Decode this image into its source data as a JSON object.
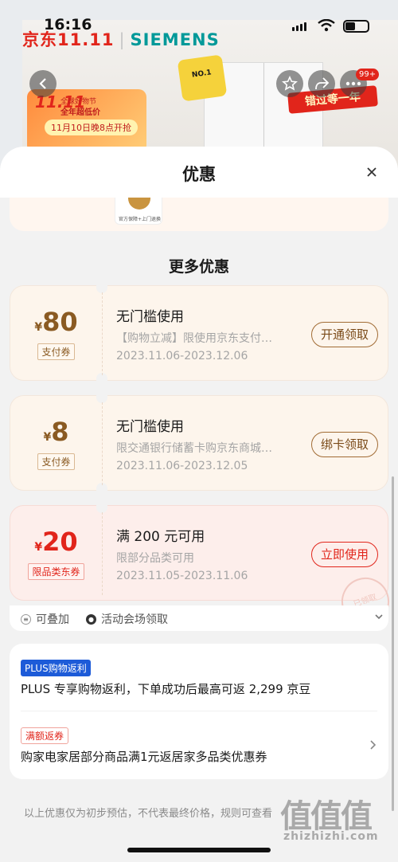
{
  "status_bar": {
    "time": "16:16"
  },
  "background": {
    "brand_jd": "京东11.11",
    "brand_siemens": "SIEMENS",
    "promo_logo": "11.11",
    "promo_line1": "全球好物节",
    "promo_line2": "全年超低价",
    "promo_pill": "11月10日晚8点开抢",
    "ribbon": "错过等一年",
    "badge_text": "NO.1",
    "cart_badge": "99+"
  },
  "sheet": {
    "title": "优惠",
    "prev_card_logo_text": "官方保障+上门退换",
    "section_title": "更多优惠",
    "coupons": [
      {
        "currency": "¥",
        "amount": "80",
        "tag": "支付券",
        "title": "无门槛使用",
        "desc": "【购物立减】限使用京东支付…",
        "date": "2023.11.06-2023.12.06",
        "button": "开通领取"
      },
      {
        "currency": "¥",
        "amount": "8",
        "tag": "支付券",
        "title": "无门槛使用",
        "desc": "限交通银行储蓄卡购京东商城…",
        "date": "2023.11.06-2023.12.05",
        "button": "绑卡领取"
      },
      {
        "currency": "¥",
        "amount": "20",
        "tag": "限品类东券",
        "title": "满 200 元可用",
        "desc": "限部分品类可用",
        "date": "2023.11.05-2023.11.06",
        "button": "立即使用",
        "stamp": "已领取"
      }
    ],
    "stack": {
      "stackable": "可叠加",
      "venue": "活动会场领取"
    },
    "info": {
      "plus_pill": "PLUS购物返利",
      "plus_text": "PLUS 专享购物返利，下单成功后最高可返 2,299 京豆",
      "manfan_pill": "满额返券",
      "manfan_text": "购家电家居部分商品满1元返居家多品类优惠券"
    },
    "disclaimer": "以上优惠仅为初步预估，不代表最终价格，规则可查看"
  },
  "watermark": {
    "logo": "值值值",
    "site": "zhizhizhi.com"
  },
  "colors": {
    "accent_red": "#e1251b",
    "coupon_brown": "#8a5a22",
    "plus_blue": "#1d5bd8"
  }
}
